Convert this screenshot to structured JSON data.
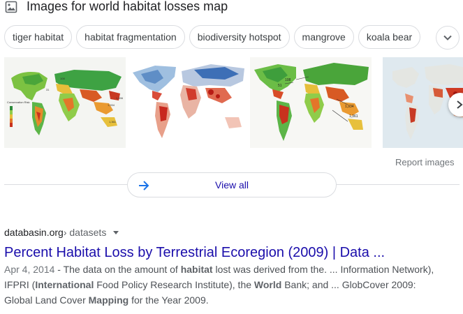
{
  "header": {
    "title": "Images for world habitat losses map",
    "icon": "image-icon"
  },
  "chips": [
    "tiger habitat",
    "habitat fragmentation",
    "biodiversity hotspot",
    "mangrove",
    "koala bear"
  ],
  "thumbs_annotations": {
    "thumb1": [
      "31",
      "108",
      "1,934",
      "1,456",
      "1,361",
      "Conservation Risk"
    ],
    "thumb3": [
      "108",
      "51",
      "1,934",
      "1,361"
    ]
  },
  "report_label": "Report images",
  "view_all_label": "View all",
  "result": {
    "domain": "databasin.org",
    "crumb": " › datasets",
    "title": "Percent Habitat Loss by Terrestrial Ecoregion (2009) | Data ...",
    "date": "Apr 4, 2014",
    "snippet_segments": [
      {
        "t": " - The data on the amount of ",
        "b": false
      },
      {
        "t": "habitat",
        "b": true
      },
      {
        "t": " lost was derived from the. ... Information Network), IFPRI (",
        "b": false
      },
      {
        "t": "International",
        "b": true
      },
      {
        "t": " Food Policy Research Institute), the ",
        "b": false
      },
      {
        "t": "World",
        "b": true
      },
      {
        "t": " Bank; and ... GlobCover 2009: Global Land Cover ",
        "b": false
      },
      {
        "t": "Mapping",
        "b": true
      },
      {
        "t": " for the Year 2009.",
        "b": false
      }
    ]
  },
  "colors": {
    "link": "#1a0dab",
    "border": "#dadce0",
    "muted": "#70757a"
  }
}
